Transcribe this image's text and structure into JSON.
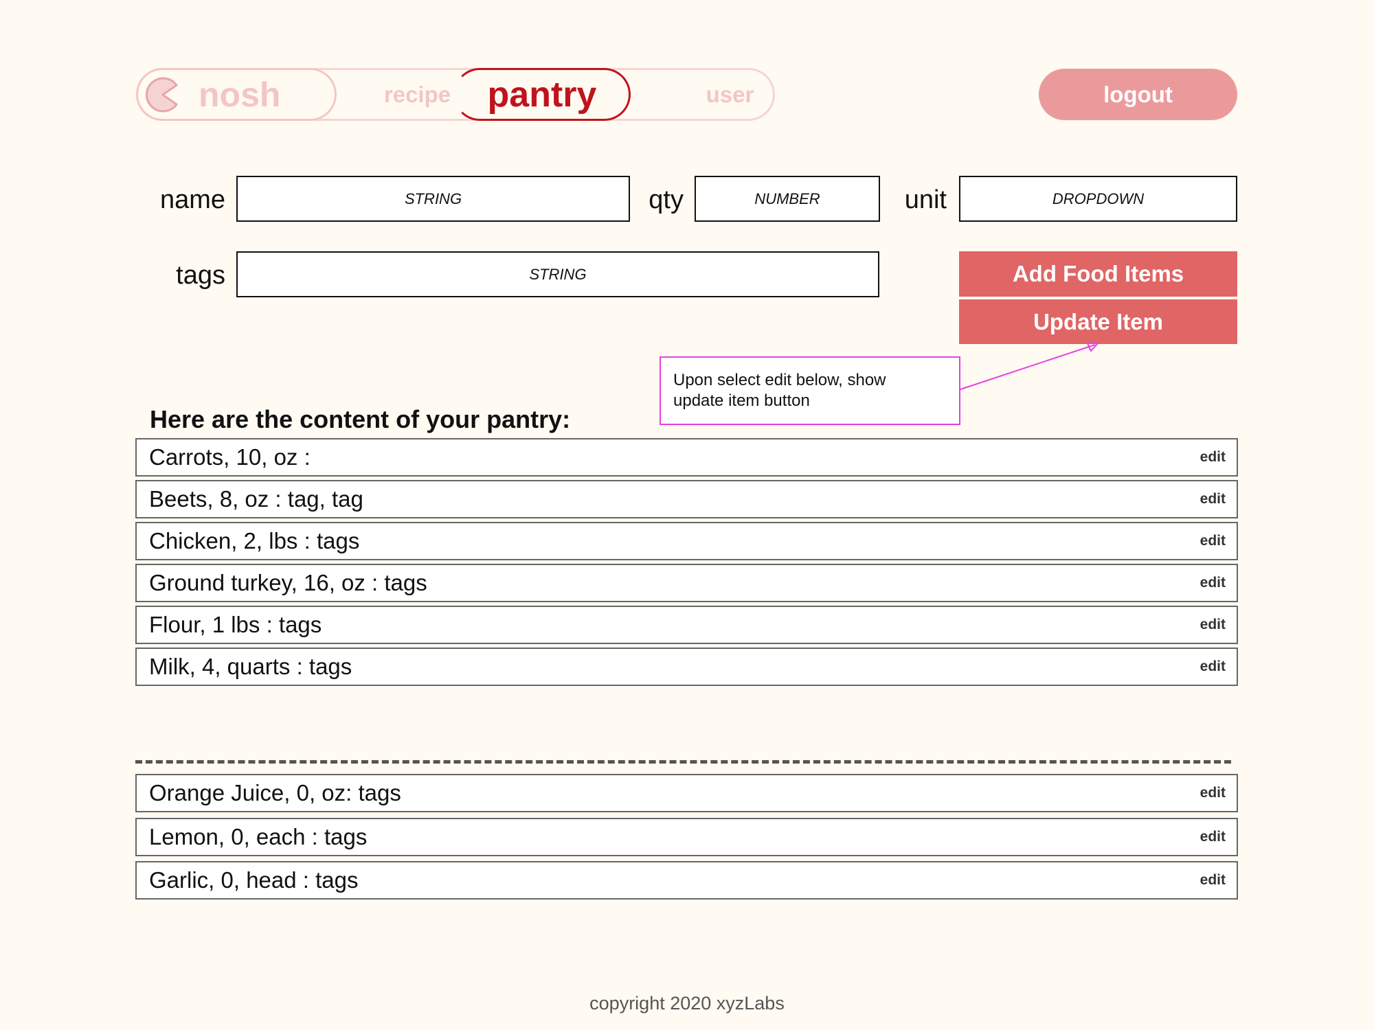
{
  "nav": {
    "brand": "nosh",
    "tabs": [
      {
        "label": "recipe"
      },
      {
        "label": "pantry"
      },
      {
        "label": "user"
      }
    ],
    "logout_label": "logout"
  },
  "form": {
    "name": {
      "label": "name",
      "placeholder": "STRING"
    },
    "qty": {
      "label": "qty",
      "placeholder": "NUMBER"
    },
    "unit": {
      "label": "unit",
      "value": "DROPDOWN"
    },
    "tags": {
      "label": "tags",
      "placeholder": "STRING"
    },
    "add_button": "Add Food Items",
    "update_button": "Update Item"
  },
  "annotation": {
    "line1": "Upon select edit below, show",
    "line2": "update item button"
  },
  "pantry": {
    "heading": "Here are the content of your pantry:",
    "items": [
      {
        "text": "Carrots, 10, oz :",
        "action": "edit"
      },
      {
        "text": "Beets, 8, oz : tag, tag",
        "action": "edit"
      },
      {
        "text": "Chicken, 2, lbs : tags",
        "action": "edit"
      },
      {
        "text": "Ground turkey, 16, oz : tags",
        "action": "edit"
      },
      {
        "text": "Flour, 1 lbs : tags",
        "action": "edit"
      },
      {
        "text": "Milk, 4, quarts : tags",
        "action": "edit"
      }
    ],
    "empty_items": [
      {
        "text": "Orange Juice, 0, oz: tags",
        "action": "edit"
      },
      {
        "text": "Lemon, 0, each : tags",
        "action": "edit"
      },
      {
        "text": "Garlic, 0, head : tags",
        "action": "edit"
      }
    ]
  },
  "footer": {
    "copyright": "copyright 2020 xyzLabs"
  },
  "colors": {
    "accent": "#c0131c",
    "button": "#e06565",
    "logout": "#eb9a9c",
    "nav_faded": "#f3c6c6",
    "annotation": "#e540e5",
    "background": "#fffaf2"
  }
}
